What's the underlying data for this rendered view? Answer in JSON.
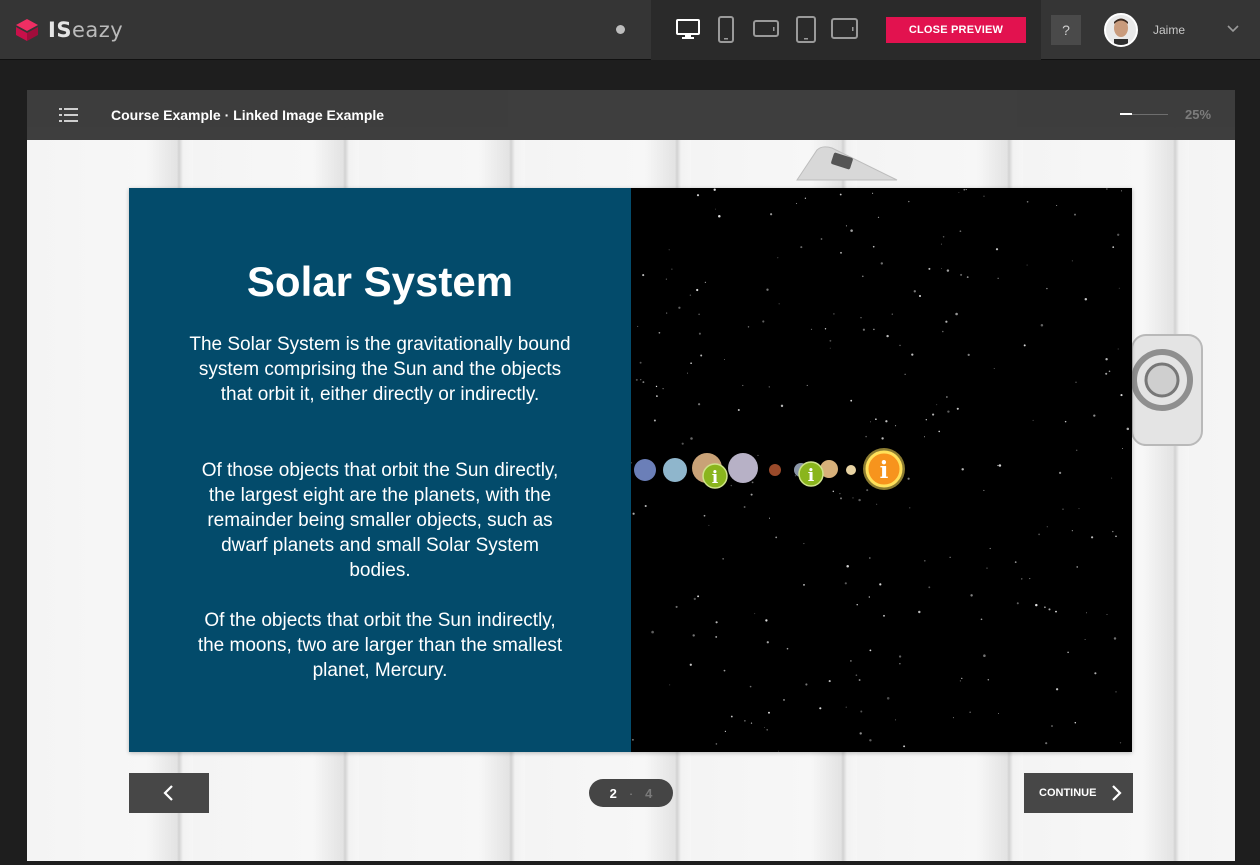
{
  "app": {
    "logo_text_bold": "IS",
    "logo_text": "eazy"
  },
  "toolbar": {
    "close_preview_label": "CLOSE PREVIEW",
    "help_label": "?",
    "user_name": "Jaime",
    "devices": [
      "desktop-icon",
      "phone-portrait-icon",
      "phone-landscape-icon",
      "tablet-portrait-icon",
      "tablet-landscape-icon"
    ]
  },
  "course": {
    "title": "Course Example · Linked Image Example",
    "progress_label": "25%",
    "progress": 0.25
  },
  "slide": {
    "title": "Solar System",
    "paragraphs": [
      "The Solar System is the gravitationally bound system comprising the Sun and the objects that orbit it, either directly or indirectly.",
      "Of those objects that orbit the Sun directly, the largest eight are the planets, with the remainder being smaller objects, such as dwarf planets and small Solar System bodies.",
      "Of the objects that orbit the Sun indirectly, the moons, two are larger than the smallest planet, Mercury."
    ],
    "hotspot_symbol": "i"
  },
  "nav": {
    "current_page": "2",
    "separator": "·",
    "total_pages": "4",
    "continue_label": "CONTINUE"
  },
  "colors": {
    "accent": "#e2124f",
    "slide_panel": "#034b6b",
    "hotspot_green": "#8ab51d",
    "hotspot_orange": "#f7941d"
  }
}
